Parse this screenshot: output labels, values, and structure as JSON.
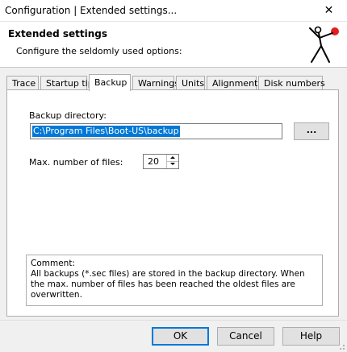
{
  "window": {
    "title": "Configuration | Extended settings..."
  },
  "header": {
    "title": "Extended settings",
    "subtitle": "Configure the seldomly used options:"
  },
  "tabs": [
    {
      "label": "Trace",
      "active": false
    },
    {
      "label": "Startup tip",
      "active": false
    },
    {
      "label": "Backup",
      "active": true
    },
    {
      "label": "Warnings",
      "active": false
    },
    {
      "label": "Units",
      "active": false
    },
    {
      "label": "Alignment",
      "active": false
    },
    {
      "label": "Disk numbers",
      "active": false
    }
  ],
  "backup": {
    "directory_label": "Backup directory:",
    "directory_value": "C:\\Program Files\\Boot-US\\backup",
    "browse_label": "...",
    "max_files_label": "Max. number of files:",
    "max_files_value": "20"
  },
  "comment": {
    "heading": "Comment:",
    "text": "All backups (*.sec files) are stored in the backup directory. When the max. number of files has been reached the oldest files are overwritten."
  },
  "buttons": {
    "ok": "OK",
    "cancel": "Cancel",
    "help": "Help"
  },
  "colors": {
    "selection": "#0078d7",
    "logo_dot": "#e02020"
  }
}
